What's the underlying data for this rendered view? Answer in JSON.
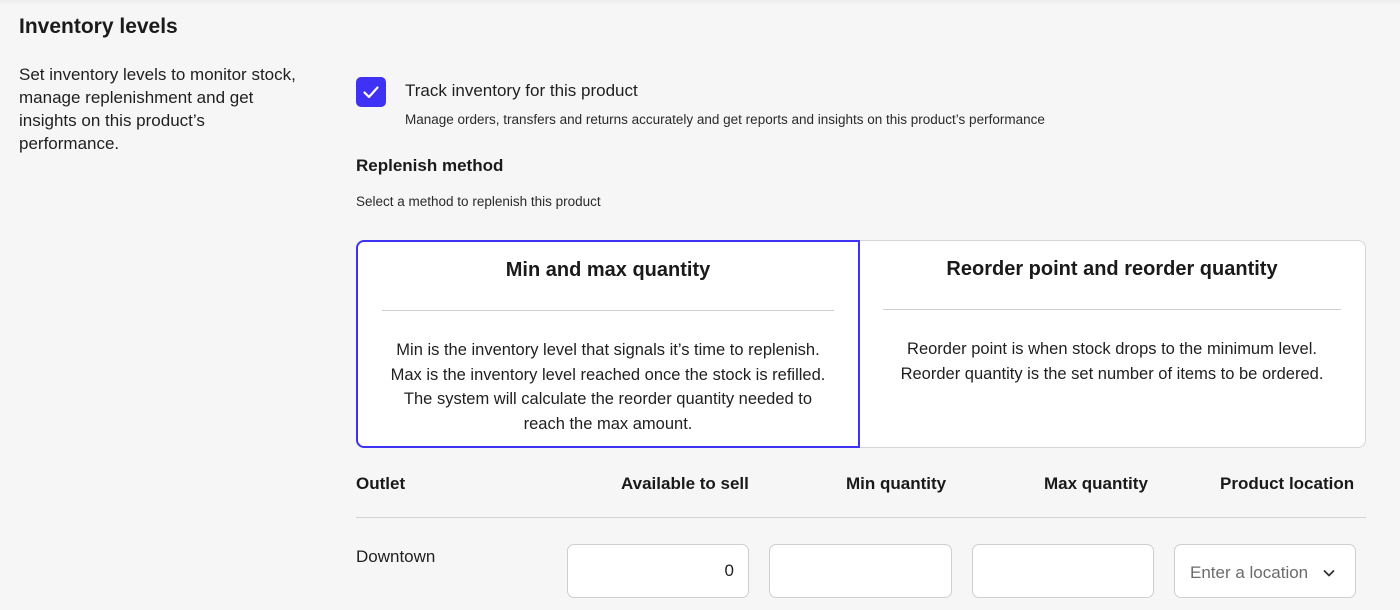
{
  "section": {
    "title": "Inventory levels",
    "description": "Set inventory levels to monitor stock, manage replenishment and get insights on this product’s performance."
  },
  "track_inventory": {
    "checked": true,
    "label": "Track inventory for this product",
    "help": "Manage orders, transfers and returns accurately and get reports and insights on this product’s performance"
  },
  "replenish": {
    "title": "Replenish method",
    "help": "Select a method to replenish this product",
    "selected": "min_max",
    "options": [
      {
        "id": "min_max",
        "title": "Min and max quantity",
        "description": "Min is the inventory level that signals it’s time to replenish. Max is the inventory level reached once the stock is refilled. The system will calculate the reorder quantity needed to reach the max amount."
      },
      {
        "id": "reorder_point",
        "title": "Reorder point and reorder quantity",
        "description": "Reorder point is when stock drops to the minimum level. Reorder quantity is the set number of items to be ordered."
      }
    ]
  },
  "table": {
    "headers": {
      "outlet": "Outlet",
      "available": "Available to sell",
      "min": "Min quantity",
      "max": "Max quantity",
      "location": "Product location"
    },
    "rows": [
      {
        "outlet": "Downtown",
        "available": "0",
        "min": "",
        "max": "",
        "location_placeholder": "Enter a location"
      }
    ]
  },
  "colors": {
    "accent": "#3f32f5",
    "background": "#f6f6f6",
    "card_border": "#d6d6d6"
  },
  "icons": {
    "checkbox_check": "check-icon",
    "select_arrow": "chevron-down-icon"
  }
}
